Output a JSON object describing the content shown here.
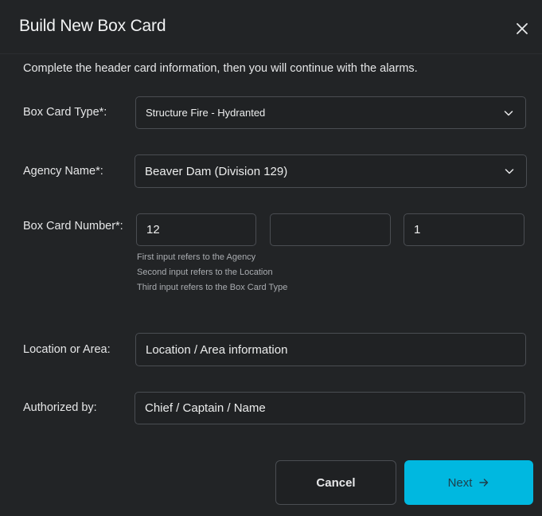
{
  "dialog": {
    "title": "Build New Box Card",
    "intro": "Complete the header card information, then you will continue with the alarms."
  },
  "form": {
    "box_card_type": {
      "label": "Box Card Type*:",
      "value": "Structure Fire - Hydranted"
    },
    "agency_name": {
      "label": "Agency Name*:",
      "value": "Beaver Dam (Division 129)"
    },
    "box_card_number": {
      "label": "Box Card Number*:",
      "input1": "12",
      "input2": "",
      "input3": "1",
      "hints": [
        "First input refers to the Agency",
        "Second input refers to the Location",
        "Third input refers to the Box Card Type"
      ]
    },
    "location": {
      "label": "Location or Area:",
      "placeholder": "Location / Area information"
    },
    "authorized_by": {
      "label": "Authorized by:",
      "placeholder": "Chief / Captain / Name"
    }
  },
  "actions": {
    "cancel_label": "Cancel",
    "next_label": "Next"
  },
  "icons": {
    "close": "close-icon",
    "dropdown": "chevron-down-icon",
    "next": "arrow-right-icon"
  },
  "colors": {
    "background": "#222426",
    "accent": "#00b8e0",
    "field_border": "#4a4d52"
  }
}
